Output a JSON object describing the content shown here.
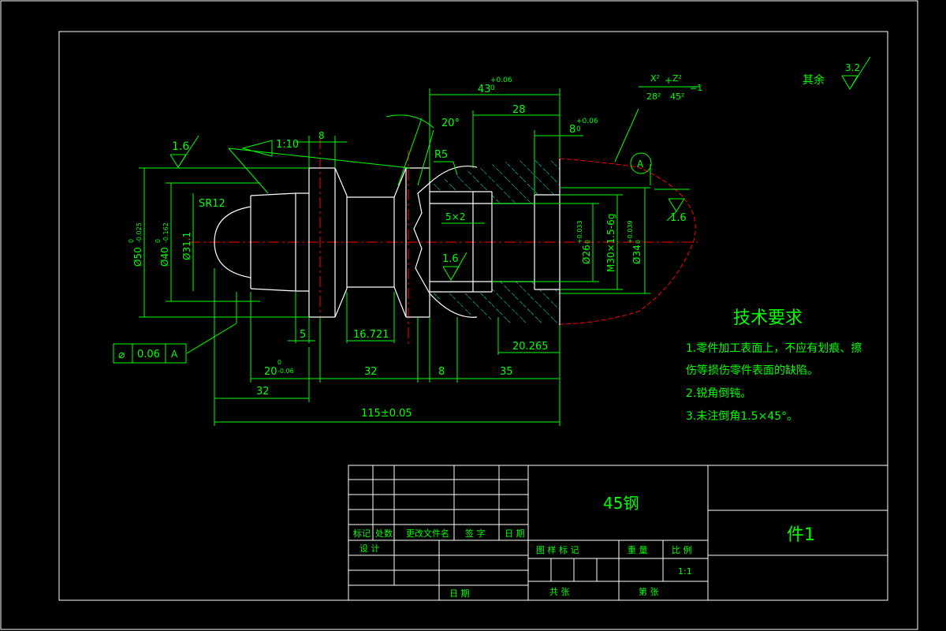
{
  "colors": {
    "background": "#000000",
    "frame": "#ffffff",
    "dimension": "#00ff00",
    "centerline": "#ff0000",
    "hatch": "#00ffff",
    "outline": "#ffffff"
  },
  "surface_finish": {
    "other": "其余",
    "other_value": "3.2",
    "top_left": "1.6",
    "right": "1.6",
    "inner": "1.6"
  },
  "ellipse_label": {
    "eq_x": "X²",
    "eq_d1": "28²",
    "eq_plus": "+",
    "eq_z": "Z²",
    "eq_d2": "45²",
    "eq_end": "=1"
  },
  "datum": "A",
  "taper": "1:10",
  "dims": {
    "d_43": "43",
    "d_43_tol": "+0.06",
    "d_43_tol2": "0",
    "d_28": "28",
    "d_8_top": "8",
    "d_8_top_tol": "+0.06",
    "d_8_top_tol2": "0",
    "d_8_left": "8",
    "angle": "20°",
    "r5": "R5",
    "sr12": "SR12",
    "dia50": "Ø50",
    "dia50_tol": "0",
    "dia50_tol2": "-0.025",
    "dia40": "Ø40",
    "dia40_tol": "0",
    "dia40_tol2": "-0.162",
    "dia31": "Ø31.1",
    "dia26": "Ø26",
    "dia26_tol": "+0.033",
    "dia26_tol2": "0",
    "m30": "M30×1.5-6g",
    "dia34": "Ø34",
    "dia34_tol": "+0.039",
    "dia34_tol2": "0",
    "groove": "5×2",
    "d_5": "5",
    "d_16721": "16.721",
    "d_20265": "20.265",
    "d_20": "20",
    "d_20_tol": "0",
    "d_20_tol2": "-0.06",
    "d_32a": "32",
    "d_8b": "8",
    "d_35": "35",
    "d_32b": "32",
    "d_115": "115±0.05"
  },
  "tolerance_frame": {
    "symbol": "⌀",
    "value": "0.06",
    "datum": "A"
  },
  "tech_req": {
    "title": "技术要求",
    "line1": "1.零件加工表面上，不应有划痕、擦",
    "line2": "伤等损伤零件表面的缺陷。",
    "line3": "2.锐角倒钝。",
    "line4": "3.未注倒角1.5×45°。"
  },
  "title_block": {
    "material": "45钢",
    "part_name": "件1",
    "h_mark": "标记",
    "h_count": "处数",
    "h_doc": "更改文件名",
    "h_sign": "签  字",
    "h_date": "日  期",
    "design": "设  计",
    "date2": "日  期",
    "pattern_mark": "图 样 标 记",
    "weight": "重  量",
    "scale": "比  例",
    "scale_value": "1:1",
    "total": "共        张",
    "sheet": "第        张"
  }
}
